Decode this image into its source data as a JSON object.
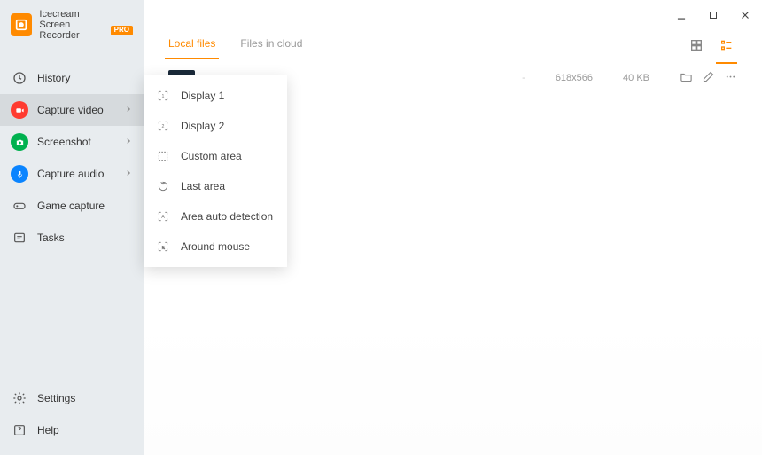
{
  "brand": {
    "name": "Icecream",
    "subtitle": "Screen Recorder",
    "badge": "PRO"
  },
  "nav": {
    "history": "History",
    "capture_video": "Capture video",
    "screenshot": "Screenshot",
    "capture_audio": "Capture audio",
    "game_capture": "Game capture",
    "tasks": "Tasks",
    "settings": "Settings",
    "help": "Help"
  },
  "tabs": {
    "local": "Local files",
    "cloud": "Files in cloud"
  },
  "file": {
    "dimensions": "618x566",
    "size": "40 KB"
  },
  "flyout": {
    "display1": "Display 1",
    "display2": "Display 2",
    "custom": "Custom area",
    "last": "Last area",
    "auto": "Area auto detection",
    "around": "Around mouse"
  }
}
